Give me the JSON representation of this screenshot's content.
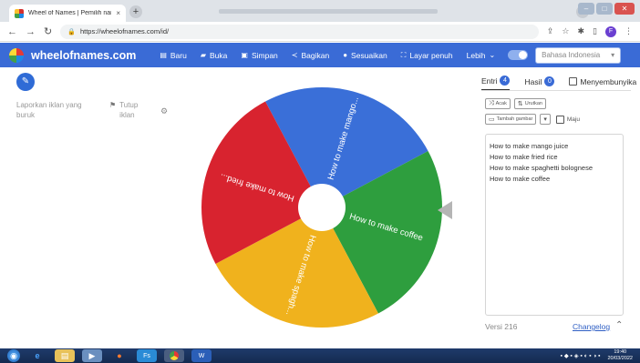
{
  "browser": {
    "tab_title": "Wheel of Names | Pemilih nama ",
    "tab_close": "×",
    "new_tab": "+",
    "url": "https://wheelofnames.com/id/",
    "profile_initial": "F"
  },
  "app": {
    "brand": "wheelofnames.com",
    "menu": [
      {
        "label": "Baru",
        "icon": "file-icon"
      },
      {
        "label": "Buka",
        "icon": "folder-icon"
      },
      {
        "label": "Simpan",
        "icon": "save-icon"
      },
      {
        "label": "Bagikan",
        "icon": "share-icon"
      },
      {
        "label": "Sesuaikan",
        "icon": "palette-icon"
      },
      {
        "label": "Layar penuh",
        "icon": "fullscreen-icon"
      },
      {
        "label": "Lebih",
        "icon": "chevron-down-icon"
      }
    ],
    "language_placeholder": "Bahasa Indonesia"
  },
  "left": {
    "ad_report": "Laporkan iklan yang buruk",
    "ad_close": "Tutup iklan"
  },
  "wheel": {
    "segments": [
      {
        "label": "How to make mango...",
        "color": "#3a6fd8"
      },
      {
        "label": "How to make coffee",
        "color": "#2e9e3e"
      },
      {
        "label": "How to make spagh...",
        "color": "#f0b21d"
      },
      {
        "label": "How to make fried...",
        "color": "#d8232f"
      }
    ]
  },
  "panel": {
    "tab_entries": "Entri",
    "tab_entries_count": "4",
    "tab_results": "Hasil",
    "tab_results_count": "0",
    "hide_label": "Menyembunyika",
    "shuffle": "Acak",
    "sort": "Urutkan",
    "add_image": "Tambah gambar",
    "advanced": "Maju",
    "entries": [
      "How to make mango juice",
      "How to make fried rice",
      "How to make spaghetti bolognese",
      "How to make coffee"
    ],
    "version": "Versi 216",
    "changelog": "Changelog"
  },
  "taskbar": {
    "time": "19:40",
    "date": "20/03/2022"
  }
}
